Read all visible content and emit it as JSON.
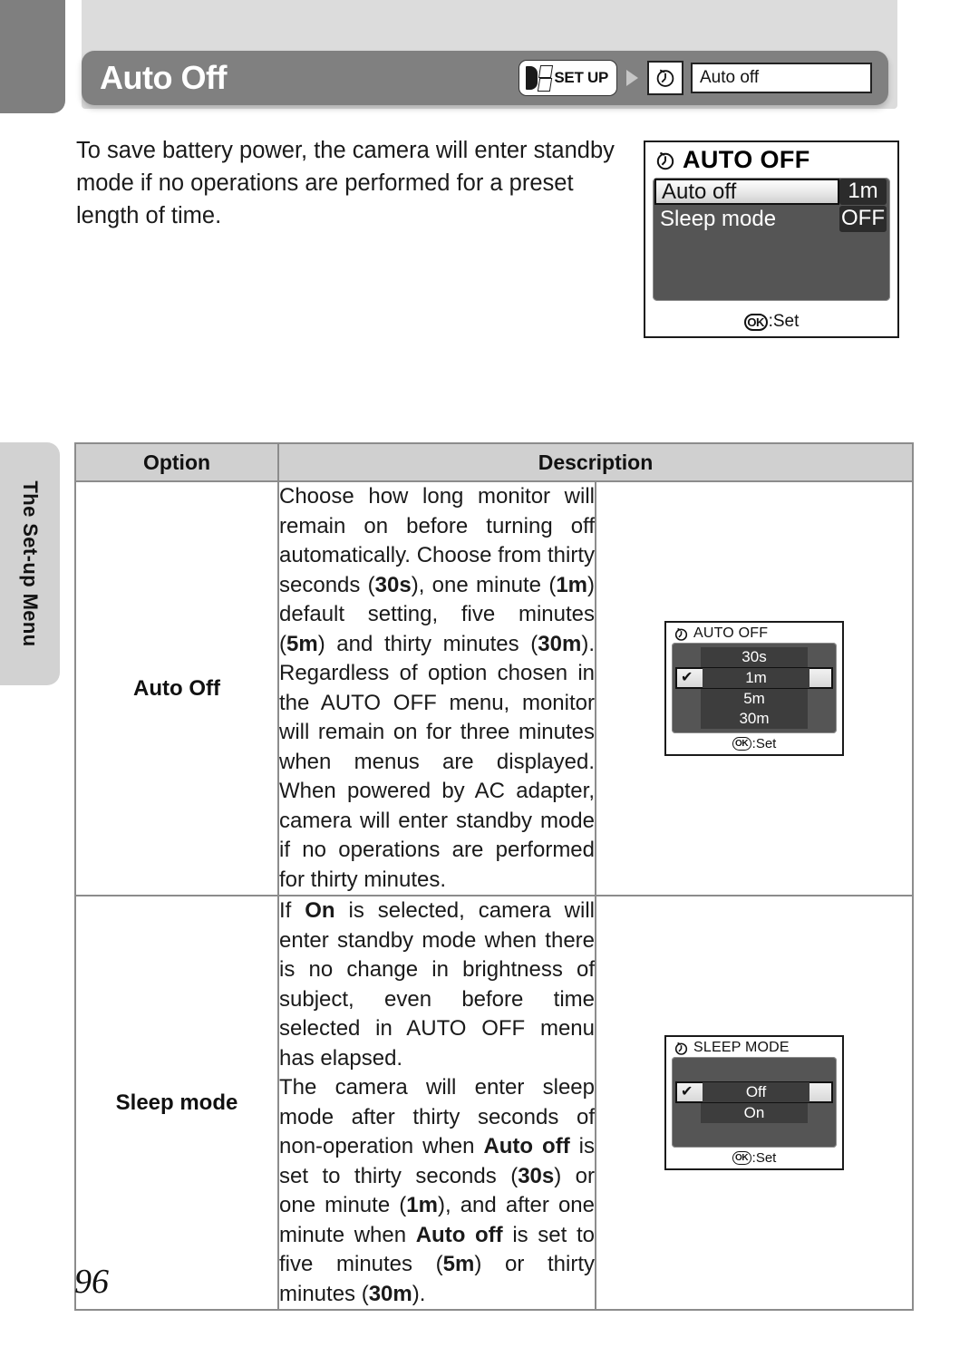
{
  "header": {
    "title": "Auto Off",
    "breadcrumb": {
      "setup_label": "SET UP",
      "field_value": "Auto off",
      "clock_icon": "clock-icon",
      "arrow_icon": "triangle-right-icon",
      "setup_icon": "setup-menu-icon"
    }
  },
  "intro": {
    "line1": "To save battery power, the camera will enter standby",
    "line2": "mode if no operations are performed for a preset",
    "line3": "length of time."
  },
  "lcd_main": {
    "title": "AUTO OFF",
    "rows": [
      {
        "label": "Auto off",
        "value": "1m",
        "selected": true
      },
      {
        "label": "Sleep mode",
        "value": "OFF",
        "selected": false
      }
    ],
    "footer_badge": "OK",
    "footer_text": ":Set"
  },
  "side_tab": {
    "label": "The Set-up Menu"
  },
  "table": {
    "headers": [
      "Option",
      "Description"
    ],
    "rows": [
      {
        "option": "Auto Off",
        "description_paragraphs": [
          "Choose how long monitor will remain on before turning off automatically. Choose from thirty seconds (30s), one minute (1m) default setting, five minutes (5m) and thirty minutes (30m). Regardless of option chosen in the AUTO OFF menu, monitor will remain on for three minutes when menus are displayed. When powered by AC adapter, camera will enter standby mode if no operations are performed for thirty minutes."
        ],
        "bold_terms": [
          "30s",
          "1m",
          "5m",
          "30m"
        ]
      },
      {
        "option": "Sleep mode",
        "description_paragraphs": [
          "If On is selected, camera will enter standby mode when there is no change in brightness of subject, even before time selected in AUTO OFF menu has elapsed.",
          "The camera will enter sleep mode after thirty seconds of non-operation when Auto off is set to thirty seconds (30s) or one minute (1m), and after one minute when Auto off is set to five minutes (5m) or thirty minutes (30m)."
        ],
        "bold_terms": [
          "On",
          "Auto off",
          "30s",
          "1m",
          "5m",
          "30m"
        ]
      }
    ]
  },
  "lcd_auto_off": {
    "title": "AUTO OFF",
    "items": [
      "30s",
      "1m",
      "5m",
      "30m"
    ],
    "selected": "1m",
    "checkmark": "✔",
    "footer_badge": "OK",
    "footer_text": ":Set"
  },
  "lcd_sleep_mode": {
    "title": "SLEEP MODE",
    "items": [
      "Off",
      "On"
    ],
    "selected": "Off",
    "checkmark": "✔",
    "footer_badge": "OK",
    "footer_text": ":Set"
  },
  "page_number": "96",
  "colors": {
    "header_bar": "#808080",
    "top_band": "#dcdcdc",
    "corner_tab": "#7f7f7f",
    "side_tab": "#d2d2d2",
    "table_header": "#d0d0d0",
    "table_border": "#8c8c8c",
    "lcd_body": "#555555"
  }
}
